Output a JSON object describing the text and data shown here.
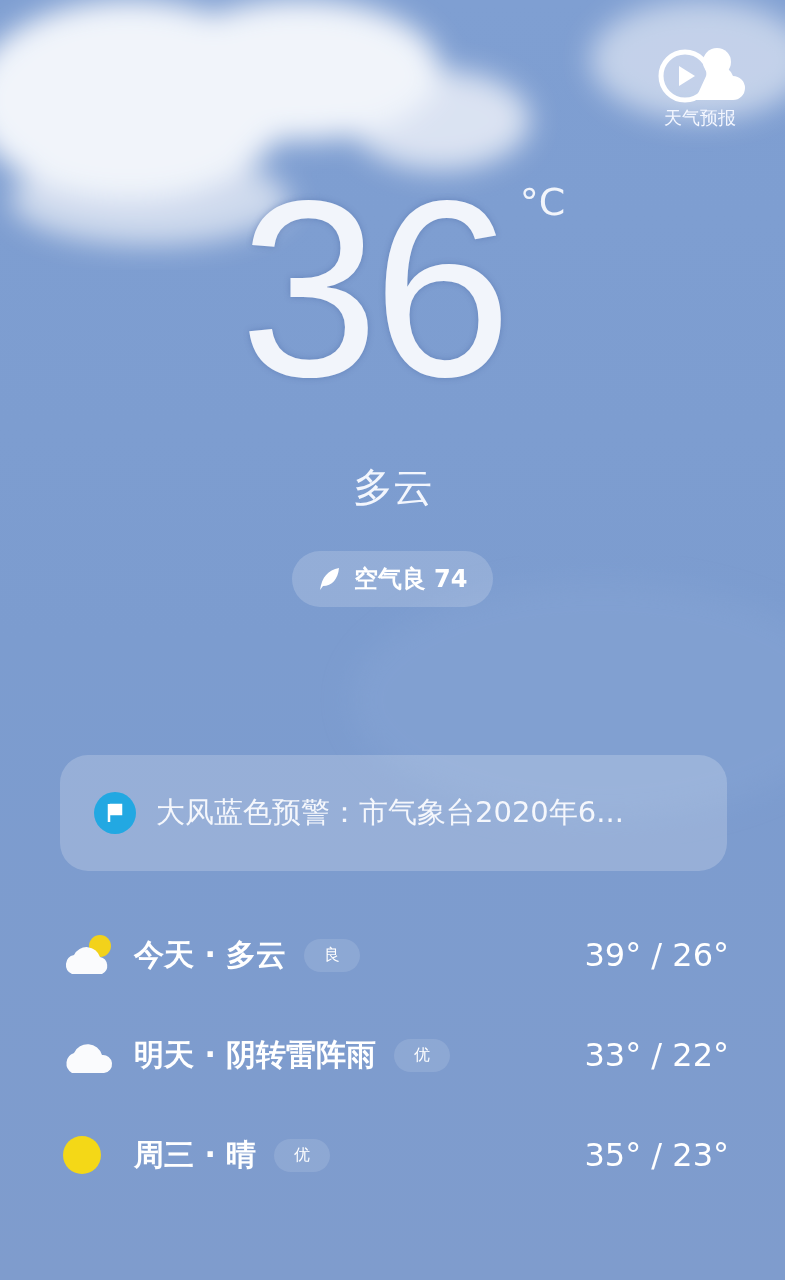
{
  "brand": {
    "label": "天气预报"
  },
  "current": {
    "temperature": "36",
    "unit": "°C",
    "condition": "多云",
    "air_quality": "空气良 74"
  },
  "alert": {
    "text": "大风蓝色预警：市气象台2020年6..."
  },
  "forecast": [
    {
      "kind": "partly_cloudy",
      "day": "今天 · 多云",
      "air": "良",
      "temps": "39° / 26°"
    },
    {
      "kind": "cloudy",
      "day": "明天 · 阴转雷阵雨",
      "air": "优",
      "temps": "33° / 22°"
    },
    {
      "kind": "sunny",
      "day": "周三 · 晴",
      "air": "优",
      "temps": "35° / 23°"
    }
  ]
}
